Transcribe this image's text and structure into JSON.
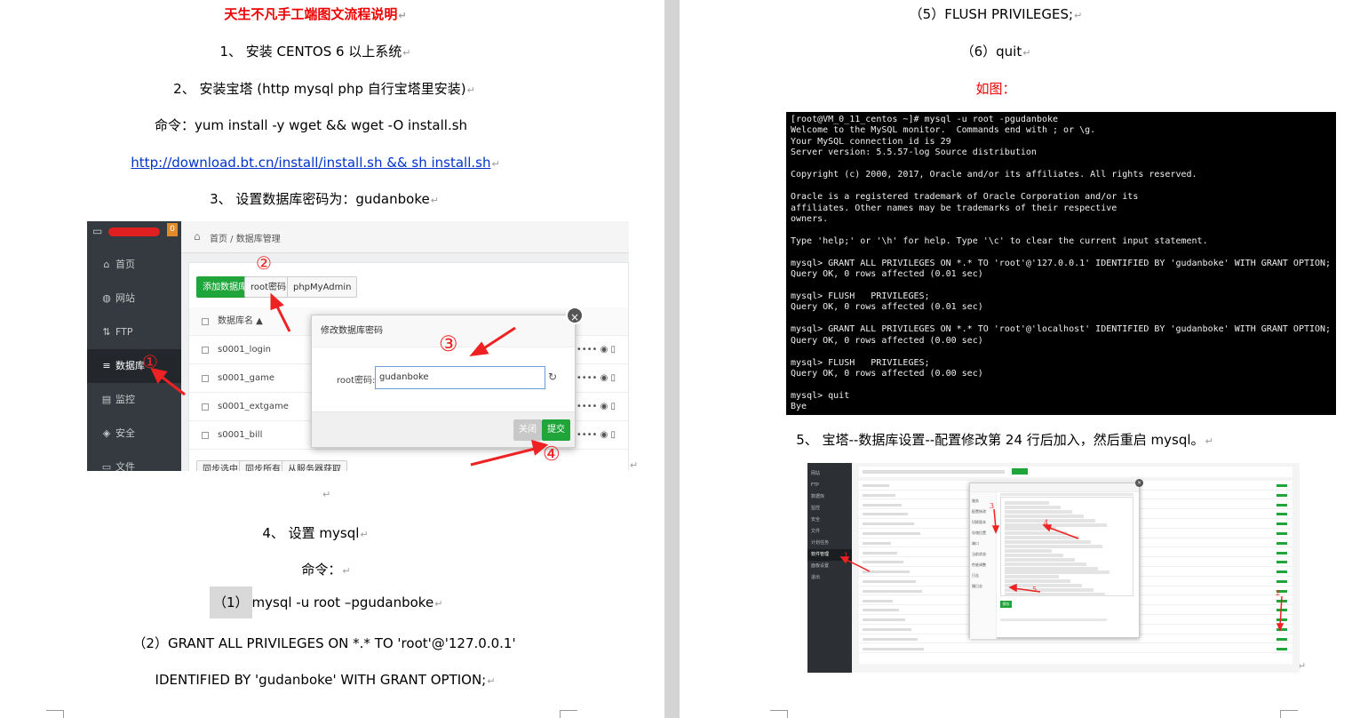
{
  "left_page": {
    "title": "天生不凡手工端图文流程说明",
    "step1": "1、 安装 CENTOS 6 以上系统",
    "step2": "2、 安装宝塔 (http mysql php 自行宝塔里安装)",
    "cmd_label_1": "命令：yum install -y wget && wget -O install.sh",
    "install_link": "http://download.bt.cn/install/install.sh && sh install.sh",
    "step3": "3、 设置数据库密码为：gudanboke",
    "step4": "4、 设置 mysql",
    "cmd_label_2": "命令：",
    "cmd1_num": "（1）",
    "cmd1_text": "mysql -u root –pgudanboke",
    "cmd2_line1": "（2）GRANT ALL PRIVILEGES ON *.* TO 'root'@'127.0.0.1'",
    "cmd2_line2": "IDENTIFIED BY 'gudanboke' WITH GRANT OPTION;"
  },
  "screenshot1": {
    "breadcrumb": "首页 / 数据库管理",
    "badge": "0",
    "sidebar": [
      {
        "icon": "home-icon",
        "glyph": "⌂",
        "label": "首页"
      },
      {
        "icon": "globe-icon",
        "glyph": "◍",
        "label": "网站"
      },
      {
        "icon": "ftp-icon",
        "glyph": "⇅",
        "label": "FTP"
      },
      {
        "icon": "database-icon",
        "glyph": "≡",
        "label": "数据库"
      },
      {
        "icon": "monitor-icon",
        "glyph": "▤",
        "label": "监控"
      },
      {
        "icon": "shield-icon",
        "glyph": "◈",
        "label": "安全"
      },
      {
        "icon": "file-icon",
        "glyph": "▭",
        "label": "文件"
      }
    ],
    "buttons": {
      "add_db": "添加数据库",
      "root_pwd": "root密码",
      "phpmyadmin": "phpMyAdmin"
    },
    "table_header": "数据库名 ▲",
    "rows": [
      "s0001_login",
      "s0001_game",
      "s0001_extgame",
      "s0001_bill"
    ],
    "row_ext": "•••••••• ◉ ▯",
    "bottom_buttons": [
      "同步选中",
      "同步所有",
      "从服务器获取"
    ],
    "annotations": [
      "①",
      "②",
      "③",
      "④"
    ],
    "modal": {
      "title": "修改数据库密码",
      "label": "root密码:",
      "value": "gudanboke",
      "close": "×",
      "refresh": "↻",
      "cancel": "关闭",
      "submit": "提交"
    },
    "colors": {
      "accent": "#20a53a",
      "arrow": "#ee2222",
      "sidebar": "#343a40"
    }
  },
  "right_page": {
    "cmd5": "（5）FLUSH   PRIVILEGES;",
    "cmd6": "（6）quit",
    "figure_label": "如图：",
    "step5": "5、 宝塔--数据库设置--配置修改第 24 行后加入，然后重启 mysql。"
  },
  "terminal": {
    "lines": [
      "[root@VM_0_11_centos ~]# mysql -u root -pgudanboke",
      "Welcome to the MySQL monitor.  Commands end with ; or \\g.",
      "Your MySQL connection id is 29",
      "Server version: 5.5.57-log Source distribution",
      "",
      "Copyright (c) 2000, 2017, Oracle and/or its affiliates. All rights reserved.",
      "",
      "Oracle is a registered trademark of Oracle Corporation and/or its",
      "affiliates. Other names may be trademarks of their respective",
      "owners.",
      "",
      "Type 'help;' or '\\h' for help. Type '\\c' to clear the current input statement.",
      "",
      "mysql> GRANT ALL PRIVILEGES ON *.* TO 'root'@'127.0.0.1' IDENTIFIED BY 'gudanboke' WITH GRANT OPTION;",
      "Query OK, 0 rows affected (0.01 sec)",
      "",
      "mysql> FLUSH   PRIVILEGES;",
      "Query OK, 0 rows affected (0.01 sec)",
      "",
      "mysql> GRANT ALL PRIVILEGES ON *.* TO 'root'@'localhost' IDENTIFIED BY 'gudanboke' WITH GRANT OPTION;",
      "Query OK, 0 rows affected (0.00 sec)",
      "",
      "mysql> FLUSH   PRIVILEGES;",
      "Query OK, 0 rows affected (0.00 sec)",
      "",
      "mysql> quit",
      "Bye"
    ]
  },
  "screenshot2": {
    "sidebar": [
      "网站",
      "FTP",
      "数据库",
      "监控",
      "安全",
      "文件",
      "计划任务",
      "软件管理",
      "面板设置",
      "退出"
    ],
    "active_index": 7,
    "dialog_tabs": [
      "服务",
      "配置修改",
      "切换版本",
      "存储位置",
      "端口",
      "当前状态",
      "性能调整",
      "日志",
      "慢日志"
    ],
    "annotations": [
      "1",
      "2",
      "3",
      "4",
      "5"
    ],
    "save_button": "保存"
  },
  "markers": {
    "paragraph": "↵",
    "return": "↵"
  }
}
